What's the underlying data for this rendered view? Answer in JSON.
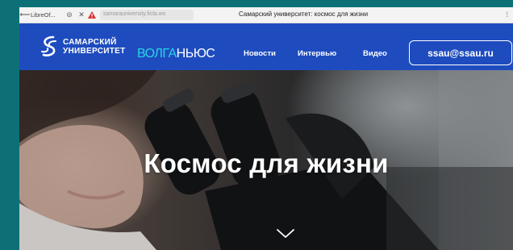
{
  "browser": {
    "back_icon": "arrow-left-icon",
    "tab_title": "LibreOf...",
    "reader_icon": "reader-view-icon",
    "close_icon": "close-icon",
    "warning_icon": "warning-triangle-icon",
    "url": "samarauniversity.ficla.ws",
    "page_title": "Самарский университет: космос для жизни",
    "menu_icon": "kebab-menu-icon"
  },
  "header": {
    "logo_line1": "САМАРСКИЙ",
    "logo_line2": "УНИВЕРСИТЕТ",
    "logo2_part1": "ВОЛГА",
    "logo2_part2": "НЬЮС",
    "nav": [
      "Новости",
      "Интервью",
      "Видео"
    ],
    "email": "ssau@ssau.ru"
  },
  "hero": {
    "title": "Космос для жизни",
    "chevron_icon": "chevron-down-icon"
  },
  "colors": {
    "background": "#0d7077",
    "header": "#1e4cbf",
    "accent": "#29d3e6"
  }
}
